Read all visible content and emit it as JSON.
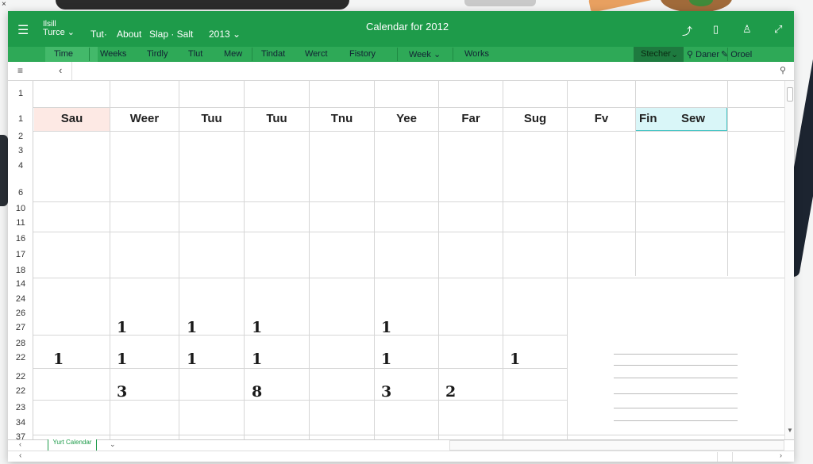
{
  "window": {
    "close_glyph": "×",
    "title": "Calendar for 2012"
  },
  "titlebar": {
    "group_top": "Ilsill",
    "group_bottom": "Turce",
    "menu": [
      "Tut·",
      "About",
      "Slap · Salt",
      "2013"
    ]
  },
  "ribbon": {
    "items": [
      "Time",
      "Weeks",
      "Tirdly",
      "Tlut",
      "Mew",
      "Tindat",
      "Werct",
      "Fistory",
      "Week",
      "Works"
    ],
    "selector": "Stecher",
    "delete": "Daner",
    "other": "Oroel"
  },
  "grid": {
    "row_numbers": [
      "1",
      "1",
      "2",
      "3",
      "4",
      "6",
      "10",
      "11",
      "16",
      "17",
      "18",
      "14",
      "24",
      "26",
      "27",
      "28",
      "22",
      "22",
      "22",
      "23",
      "34",
      "37"
    ],
    "days": [
      "Sau",
      "Weer",
      "Tuu",
      "Tuu",
      "Tnu",
      "Yee",
      "Far",
      "Sug",
      "Fv"
    ],
    "highlight": [
      "Fin",
      "Sew"
    ],
    "values": {
      "row_a": [
        "1",
        "1",
        "1",
        "1"
      ],
      "row_b": [
        "1",
        "1",
        "1",
        "1",
        "1",
        "1"
      ],
      "row_c": [
        "3",
        "8",
        "3",
        "2"
      ]
    }
  },
  "sheets": {
    "tab_label": "Yurt Calendar"
  },
  "colors": {
    "accent": "#1e9b4a",
    "ribbon": "#2ea957",
    "highlight_cyan": "#d9f6f8",
    "highlight_pink": "#fde9e4"
  },
  "icons": {
    "menu": "hamburger-icon",
    "back": "chevron-left-icon",
    "search": "search-icon"
  }
}
